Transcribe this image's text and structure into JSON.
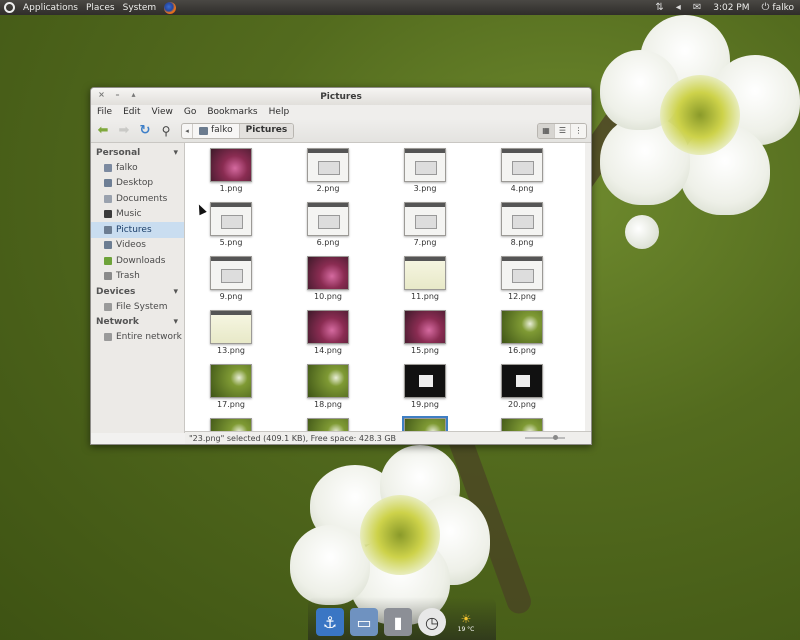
{
  "top_panel": {
    "menus": [
      "Applications",
      "Places",
      "System"
    ],
    "clock": "3:02 PM",
    "user": "falko",
    "icons": [
      "ubuntu-logo",
      "firefox-icon",
      "network-icon",
      "volume-icon",
      "mail-icon",
      "power-icon"
    ]
  },
  "window": {
    "title": "Pictures",
    "controls": [
      "×",
      "–",
      "▴"
    ],
    "menu": [
      "File",
      "Edit",
      "View",
      "Go",
      "Bookmarks",
      "Help"
    ],
    "toolbar": {
      "path": [
        "falko",
        "Pictures"
      ],
      "path_left_arrow": "◂"
    },
    "sidebar": {
      "personal_header": "Personal",
      "personal": [
        {
          "label": "falko",
          "icon": "home-icon",
          "color": "#7c8aa0"
        },
        {
          "label": "Desktop",
          "icon": "desktop-icon",
          "color": "#6e7f95"
        },
        {
          "label": "Documents",
          "icon": "documents-icon",
          "color": "#9aa2ae"
        },
        {
          "label": "Music",
          "icon": "music-icon",
          "color": "#3b3b3b"
        },
        {
          "label": "Pictures",
          "icon": "pictures-icon",
          "color": "#6c7d92"
        },
        {
          "label": "Videos",
          "icon": "videos-icon",
          "color": "#6c7d92"
        },
        {
          "label": "Downloads",
          "icon": "downloads-icon",
          "color": "#6ea33a"
        },
        {
          "label": "Trash",
          "icon": "trash-icon",
          "color": "#8a8a8a"
        }
      ],
      "selected": "Pictures",
      "devices_header": "Devices",
      "devices": [
        {
          "label": "File System",
          "icon": "filesystem-icon",
          "color": "#9a9a9a"
        }
      ],
      "network_header": "Network",
      "network": [
        {
          "label": "Entire network",
          "icon": "network-icon",
          "color": "#9a9a9a"
        }
      ]
    },
    "files": [
      {
        "name": "1.png",
        "style": "t-purple"
      },
      {
        "name": "2.png",
        "style": "t-white"
      },
      {
        "name": "3.png",
        "style": "t-white"
      },
      {
        "name": "4.png",
        "style": "t-white"
      },
      {
        "name": "5.png",
        "style": "t-white"
      },
      {
        "name": "6.png",
        "style": "t-white"
      },
      {
        "name": "7.png",
        "style": "t-white"
      },
      {
        "name": "8.png",
        "style": "t-white"
      },
      {
        "name": "9.png",
        "style": "t-white"
      },
      {
        "name": "10.png",
        "style": "t-purple"
      },
      {
        "name": "11.png",
        "style": "t-sheet"
      },
      {
        "name": "12.png",
        "style": "t-white"
      },
      {
        "name": "13.png",
        "style": "t-sheet"
      },
      {
        "name": "14.png",
        "style": "t-purple"
      },
      {
        "name": "15.png",
        "style": "t-purple"
      },
      {
        "name": "16.png",
        "style": "t-green"
      },
      {
        "name": "17.png",
        "style": "t-green"
      },
      {
        "name": "18.png",
        "style": "t-green"
      },
      {
        "name": "19.png",
        "style": "t-dark"
      },
      {
        "name": "20.png",
        "style": "t-dark"
      },
      {
        "name": "",
        "style": "t-green"
      },
      {
        "name": "",
        "style": "t-green"
      },
      {
        "name": "",
        "style": "t-green",
        "selected": true
      },
      {
        "name": "",
        "style": "t-green"
      }
    ],
    "status": "\"23.png\" selected (409.1 KB), Free space: 428.3 GB"
  },
  "dock": {
    "icons": [
      "anchor-icon",
      "folder-icon",
      "trash-can-icon",
      "clock-icon",
      "weather-icon"
    ],
    "weather_temp": "19 °C"
  }
}
